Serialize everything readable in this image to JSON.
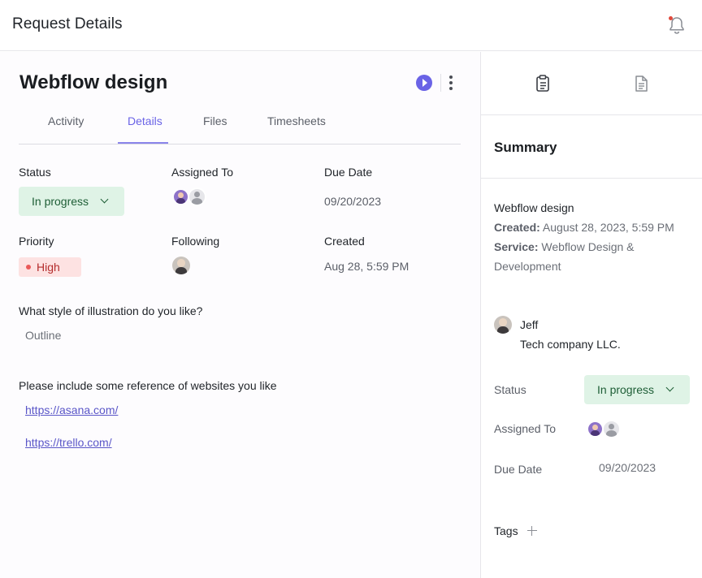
{
  "header": {
    "title": "Request Details",
    "bell_icon": "bell-icon",
    "notification_dot_color": "#e0483b"
  },
  "request": {
    "title": "Webflow design"
  },
  "tabs": [
    {
      "label": "Activity",
      "active": false
    },
    {
      "label": "Details",
      "active": true
    },
    {
      "label": "Files",
      "active": false
    },
    {
      "label": "Timesheets",
      "active": false
    }
  ],
  "details": {
    "status_label": "Status",
    "status_value": "In progress",
    "assigned_label": "Assigned To",
    "due_label": "Due Date",
    "due_value": "09/20/2023",
    "priority_label": "Priority",
    "priority_value": "High",
    "following_label": "Following",
    "created_label": "Created",
    "created_value": "Aug 28, 5:59 PM"
  },
  "questions": [
    {
      "question": "What style of illustration do you like?",
      "answer": "Outline"
    },
    {
      "question": "Please include some reference of websites you like",
      "links": [
        "https://asana.com/",
        "https://trello.com/"
      ]
    }
  ],
  "sidebar": {
    "icons": [
      "clipboard-icon",
      "document-icon"
    ],
    "summary_title": "Summary",
    "request_name": "Webflow design",
    "created_key": "Created:",
    "created_value": "August 28, 2023, 5:59 PM",
    "service_key": "Service:",
    "service_value": "Webflow Design & Development",
    "client_name": "Jeff",
    "client_company": "Tech company LLC.",
    "status_label": "Status",
    "status_value": "In progress",
    "assigned_label": "Assigned To",
    "due_label": "Due Date",
    "due_value": "09/20/2023",
    "tags_label": "Tags"
  },
  "colors": {
    "accent": "#6a63e6",
    "status_bg": "#dff3e6",
    "status_text": "#1e5e36",
    "priority_bg": "#fde2e2",
    "priority_text": "#b42c2c"
  }
}
